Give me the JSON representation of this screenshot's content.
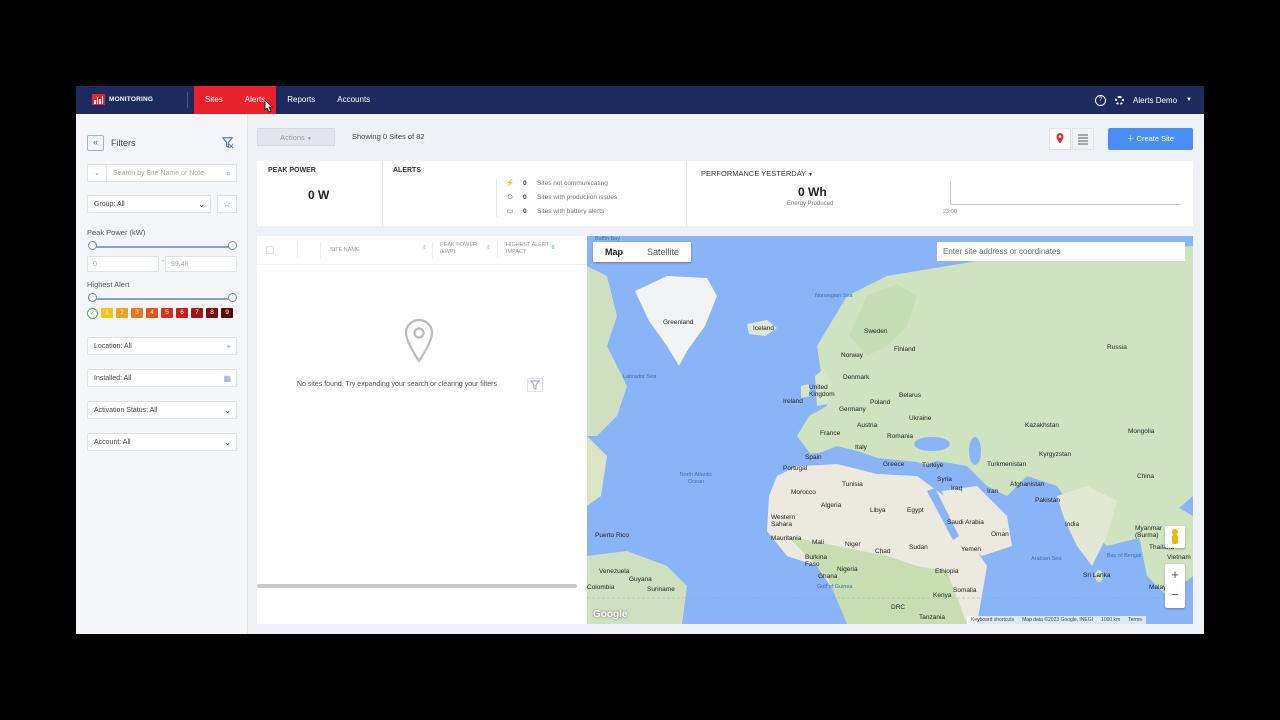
{
  "brand": {
    "name": "MONITORING"
  },
  "nav": {
    "tabs": [
      {
        "label": "Sites"
      },
      {
        "label": "Alerts"
      },
      {
        "label": "Reports"
      },
      {
        "label": "Accounts"
      }
    ]
  },
  "user": {
    "name": "Alerts Demo"
  },
  "sidebar": {
    "title": "Filters",
    "search_placeholder": "Search by Site Name or Note",
    "group_label": "Group: All",
    "peak_power_label": "Peak Power (kW)",
    "peak_min": "0",
    "peak_max": "99.48",
    "range_dash": "-",
    "highest_alert_label": "Highest Alert",
    "alert_levels": [
      "1",
      "2",
      "3",
      "4",
      "5",
      "6",
      "7",
      "8",
      "9"
    ],
    "alert_colors": [
      "#f5c518",
      "#f0a020",
      "#e8761e",
      "#e5521b",
      "#d92d1e",
      "#c41f1a",
      "#a31414",
      "#7e0d0d",
      "#5a0606"
    ],
    "location_label": "Location: All",
    "installed_label": "Installed: All",
    "activation_label": "Activation Status: All",
    "account_label": "Account: All"
  },
  "toolbar": {
    "actions_label": "Actions",
    "showing_text": "Showing 0 Sites of 82",
    "create_label": "Create Site"
  },
  "stats": {
    "peak_title": "PEAK POWER",
    "peak_value": "0 W",
    "alerts_title": "ALERTS",
    "alerts": [
      {
        "count": "0",
        "text": "Sites not communicating"
      },
      {
        "count": "0",
        "text": "Sites with production issues"
      },
      {
        "count": "0",
        "text": "Sites with battery alerts"
      }
    ],
    "perf_title": "PERFORMANCE YESTERDAY",
    "energy_value": "0 Wh",
    "energy_label": "Energy Produced",
    "chart_time": "23:00"
  },
  "table": {
    "col_site": "SITE NAME",
    "col_peak": "PEAK POWER (kWP)",
    "col_alert": "HIGHEST ALERT IMPACT",
    "empty_msg": "No sites found. Try expanding your search or clearing your filters"
  },
  "map": {
    "tab_map": "Map",
    "tab_sat": "Satellite",
    "search_placeholder": "Enter site address or coordinates",
    "countries": [
      "Greenland",
      "Iceland",
      "Sweden",
      "Finland",
      "Norway",
      "Russia",
      "United Kingdom",
      "Denmark",
      "Ireland",
      "Belarus",
      "Germany",
      "Poland",
      "Ukraine",
      "Kazakhstan",
      "France",
      "Austria",
      "Romania",
      "Mongolia",
      "Spain",
      "Italy",
      "Portugal",
      "Greece",
      "Türkiye",
      "Turkmenistan",
      "Kyrgyzstan",
      "Tunisia",
      "Syria",
      "Iraq",
      "Iran",
      "Afghanistan",
      "China",
      "Morocco",
      "Algeria",
      "Libya",
      "Egypt",
      "Pakistan",
      "Western Sahara",
      "Saudi Arabia",
      "India",
      "Mauritania",
      "Mali",
      "Niger",
      "Chad",
      "Sudan",
      "Oman",
      "Yemen",
      "Myanmar (Burma)",
      "Thailand",
      "Burkina Faso",
      "Nigeria",
      "Ethiopia",
      "Puerto Rico",
      "Venezuela",
      "Guyana",
      "Ghana",
      "Somalia",
      "Suriname",
      "Colombia",
      "DRC",
      "Kenya",
      "Tanzania",
      "Malaysia",
      "Vietnam",
      "Sri Lanka"
    ],
    "seas": [
      "Norwegian Sea",
      "Labrador Sea",
      "North Atlantic Ocean",
      "Arabian Sea",
      "Bay of Bengal",
      "Gulf of Guinea",
      "Baffin Bay"
    ],
    "attrib": [
      "Keyboard shortcuts",
      "Map data ©2023 Google, INEGI",
      "1000 km",
      "Terms"
    ],
    "logo": "Google"
  },
  "colors": {
    "nav_bg": "#1c2a5e",
    "accent": "#e8212b",
    "primary_btn": "#4a8ef5"
  }
}
